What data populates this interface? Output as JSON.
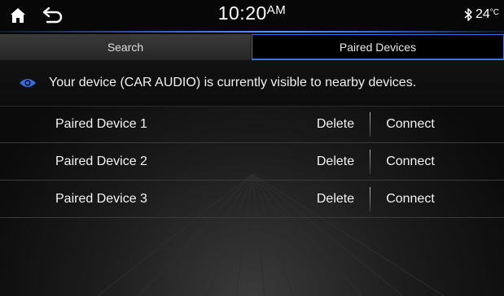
{
  "statusbar": {
    "home_icon": "home-icon",
    "back_icon": "back-arrow-icon",
    "time": "10:20",
    "ampm": "AM",
    "bluetooth_icon": "bluetooth-icon",
    "temperature": "24",
    "temperature_unit": "°C"
  },
  "tabs": [
    {
      "label": "Search",
      "active": false
    },
    {
      "label": "Paired Devices",
      "active": true
    }
  ],
  "notice": {
    "icon": "eye-icon",
    "text": "Your device (CAR AUDIO) is currently visible to nearby devices."
  },
  "devices": [
    {
      "name": "Paired Device 1",
      "delete_label": "Delete",
      "connect_label": "Connect"
    },
    {
      "name": "Paired Device 2",
      "delete_label": "Delete",
      "connect_label": "Connect"
    },
    {
      "name": "Paired Device 3",
      "delete_label": "Delete",
      "connect_label": "Connect"
    }
  ],
  "colors": {
    "accent": "#3b74e0",
    "eye_icon": "#2f6fe8"
  }
}
